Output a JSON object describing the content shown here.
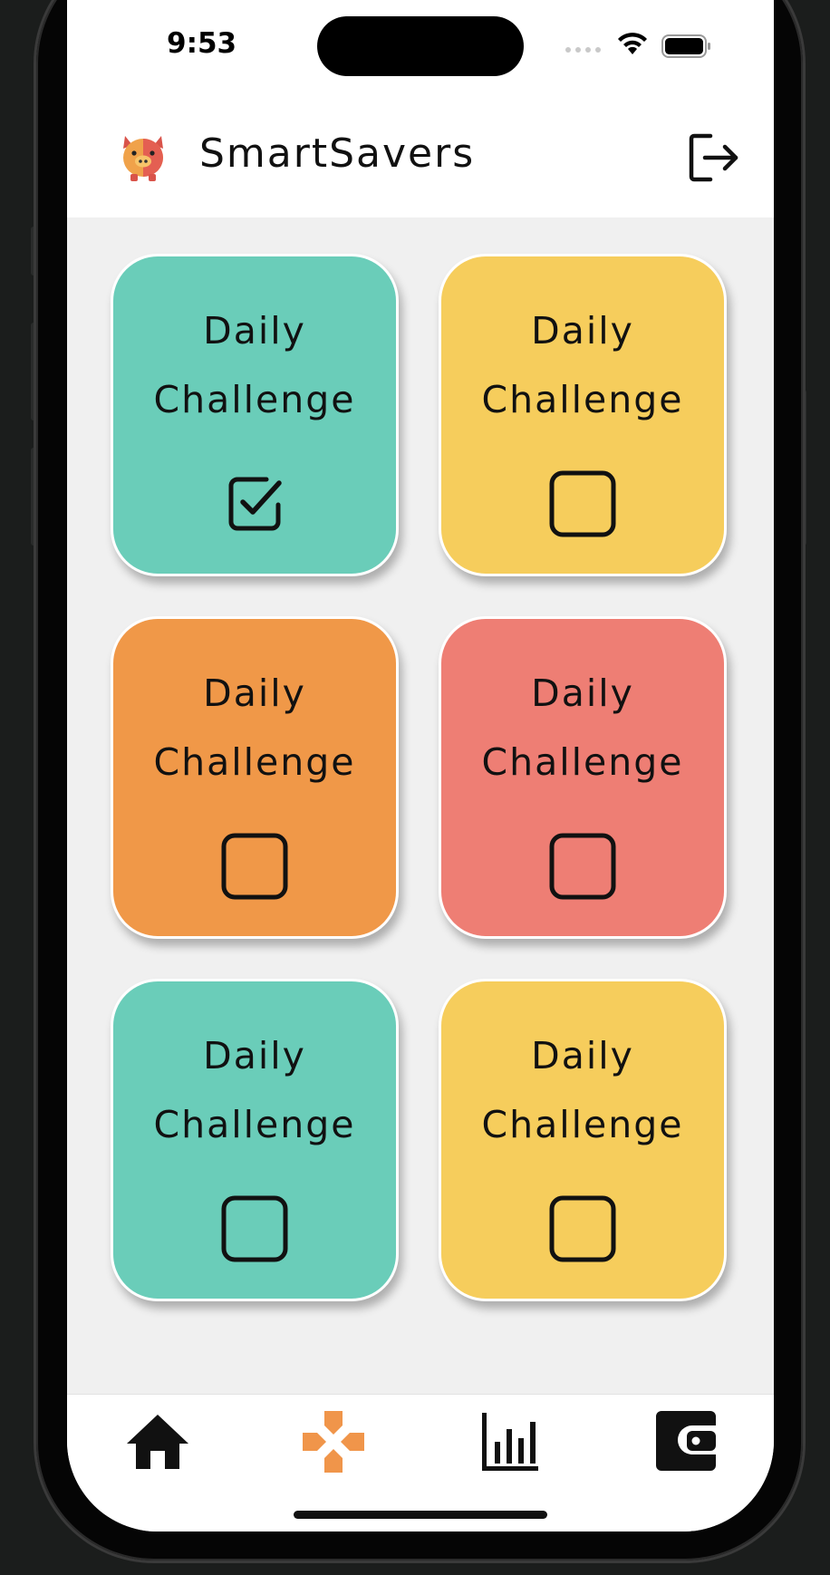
{
  "status_bar": {
    "time": "9:53"
  },
  "header": {
    "app_title": "SmartSavers"
  },
  "colors": {
    "teal": "#6acdb9",
    "yellow": "#f6cd5c",
    "orange": "#f09848",
    "coral": "#ee7e74",
    "active_tab": "#f0954a"
  },
  "cards": [
    {
      "line1": "Daily",
      "line2": "Challenge",
      "checked": true,
      "color": "#6acdb9"
    },
    {
      "line1": "Daily",
      "line2": "Challenge",
      "checked": false,
      "color": "#f6cd5c"
    },
    {
      "line1": "Daily",
      "line2": "Challenge",
      "checked": false,
      "color": "#f09848"
    },
    {
      "line1": "Daily",
      "line2": "Challenge",
      "checked": false,
      "color": "#ee7e74"
    },
    {
      "line1": "Daily",
      "line2": "Challenge",
      "checked": false,
      "color": "#6acdb9"
    },
    {
      "line1": "Daily",
      "line2": "Challenge",
      "checked": false,
      "color": "#f6cd5c"
    }
  ],
  "tabs": [
    {
      "icon": "home-icon",
      "active": false
    },
    {
      "icon": "challenges-icon",
      "active": true
    },
    {
      "icon": "stats-icon",
      "active": false
    },
    {
      "icon": "wallet-icon",
      "active": false
    }
  ]
}
